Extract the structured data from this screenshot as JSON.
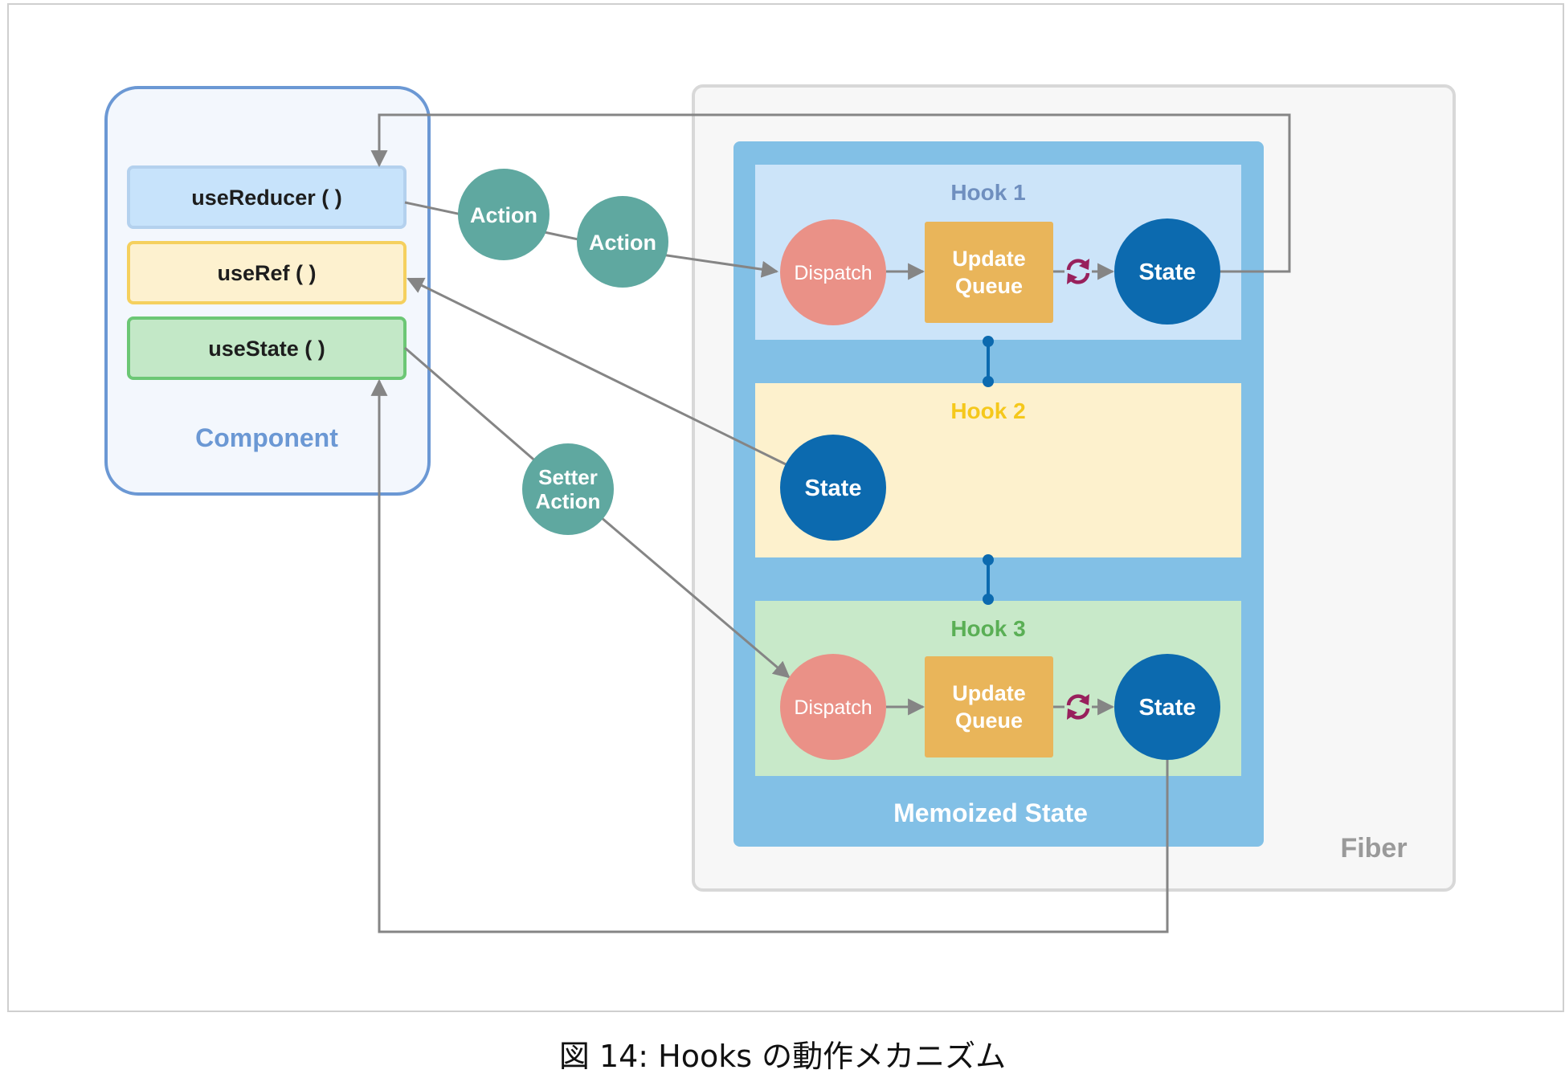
{
  "component": {
    "title": "Component",
    "hooks": [
      {
        "label": "useReducer ( )"
      },
      {
        "label": "useRef ( )"
      },
      {
        "label": "useState ( )"
      }
    ]
  },
  "actions": {
    "action_1": "Action",
    "action_2": "Action",
    "setter_line1": "Setter",
    "setter_line2": "Action"
  },
  "fiber": {
    "title": "Fiber",
    "memoized_state": "Memoized State",
    "hook1": {
      "title": "Hook 1",
      "dispatch": "Dispatch",
      "queue_line1": "Update",
      "queue_line2": "Queue",
      "state": "State"
    },
    "hook2": {
      "title": "Hook 2",
      "state": "State"
    },
    "hook3": {
      "title": "Hook 3",
      "dispatch": "Dispatch",
      "queue_line1": "Update",
      "queue_line2": "Queue",
      "state": "State"
    }
  },
  "caption": "図 14: Hooks の動作メカニズム",
  "colors": {
    "component_border": "#6b98d4",
    "component_fill": "#f3f7fd",
    "reducer_fill": "#c7e3fb",
    "ref_fill": "#fdf1cf",
    "ref_border": "#f5d05e",
    "state_hook_fill": "#c3e8c7",
    "state_hook_border": "#6cc775",
    "action_circle": "#5fa8a0",
    "memoized_fill": "#82c0e6",
    "hook1_fill": "#cce4f9",
    "hook2_fill": "#fdf1cd",
    "hook3_fill": "#c8e9c9",
    "hook1_title": "#6f8fbf",
    "hook2_title": "#f5c81b",
    "hook3_title": "#5aaf55",
    "dispatch_fill": "#ea9187",
    "queue_fill": "#e9b55a",
    "state_fill": "#0c6aaf",
    "cycle_icon": "#98205c",
    "connector": "#858585",
    "fiber_border": "#d8d8d8",
    "fiber_fill": "#f7f7f7"
  }
}
